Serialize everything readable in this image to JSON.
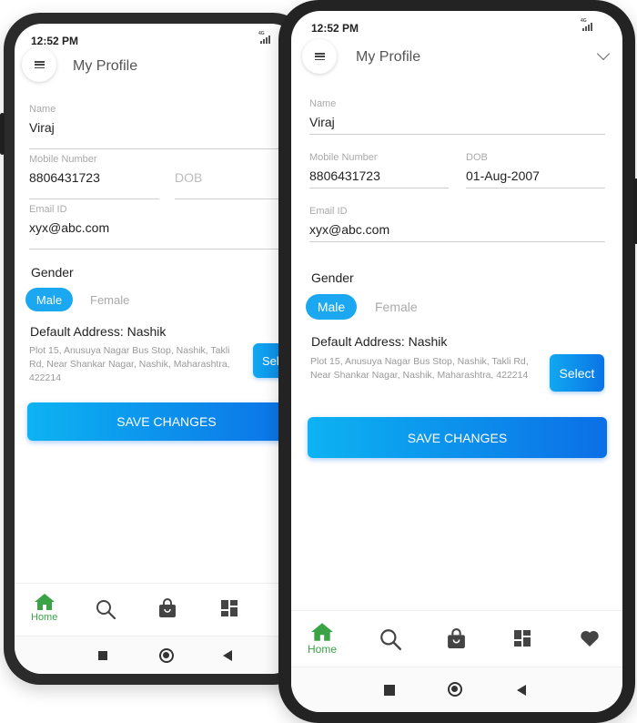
{
  "back_phone": {
    "status_time": "12:52 PM",
    "signal_label": "4G",
    "title": "My Profile",
    "fields": {
      "name": {
        "label": "Name",
        "value": "Viraj"
      },
      "mobile": {
        "label": "Mobile Number",
        "value": "8806431723"
      },
      "dob": {
        "label": "DOB",
        "value": ""
      },
      "email": {
        "label": "Email ID",
        "value": "xyx@abc.com"
      }
    },
    "gender": {
      "label": "Gender",
      "options": [
        "Male",
        "Female"
      ],
      "selected": "Male"
    },
    "address": {
      "title": "Default Address: Nashik",
      "text": "Plot 15, Anusuya Nagar Bus Stop, Nashik, Takli Rd, Near Shankar Nagar, Nashik, Maharashtra, 422214",
      "select_label": "Selc"
    },
    "save_label": "SAVE CHANGES",
    "nav": [
      {
        "icon": "home-icon",
        "label": "Home",
        "active": true
      },
      {
        "icon": "search-icon",
        "label": ""
      },
      {
        "icon": "shopping-bag-icon",
        "label": ""
      },
      {
        "icon": "dashboard-icon",
        "label": ""
      }
    ]
  },
  "front_phone": {
    "status_time": "12:52 PM",
    "signal_label": "4G",
    "title": "My Profile",
    "fields": {
      "name": {
        "label": "Name",
        "value": "Viraj"
      },
      "mobile": {
        "label": "Mobile Number",
        "value": "8806431723"
      },
      "dob": {
        "label": "DOB",
        "value": "01-Aug-2007"
      },
      "email": {
        "label": "Email ID",
        "value": "xyx@abc.com"
      }
    },
    "gender": {
      "label": "Gender",
      "options": [
        "Male",
        "Female"
      ],
      "selected": "Male"
    },
    "address": {
      "title": "Default Address: Nashik",
      "text": "Plot 15, Anusuya Nagar Bus Stop, Nashik, Takli Rd, Near Shankar Nagar, Nashik, Maharashtra, 422214",
      "select_label": "Select"
    },
    "save_label": "SAVE CHANGES",
    "nav": [
      {
        "icon": "home-icon",
        "label": "Home",
        "active": true
      },
      {
        "icon": "search-icon",
        "label": ""
      },
      {
        "icon": "shopping-bag-icon",
        "label": ""
      },
      {
        "icon": "dashboard-icon",
        "label": ""
      },
      {
        "icon": "heart-icon",
        "label": ""
      }
    ]
  },
  "colors": {
    "accent": "#1ba8f0",
    "gradient_start": "#0db3f2",
    "gradient_end": "#0b6fe6",
    "nav_active": "#3aa346",
    "frame": "#2b2b2b"
  }
}
